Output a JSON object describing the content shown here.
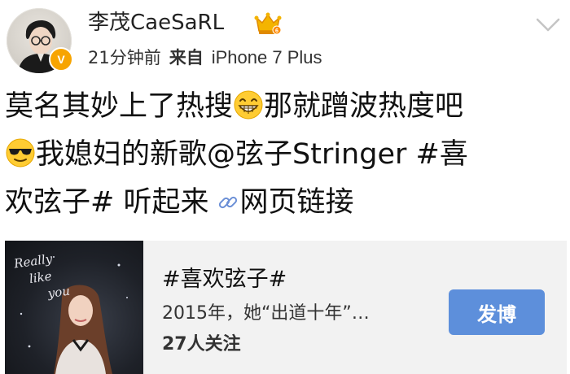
{
  "header": {
    "username": "李茂CaeSaRL",
    "verified_badge": "V",
    "time_ago": "21分钟前",
    "source_label": "来自",
    "device": "iPhone 7 Plus",
    "icons": {
      "avatar": "avatar-photo",
      "vip": "crown-icon",
      "menu": "chevron-down-icon"
    }
  },
  "post": {
    "line1_a": "莫名其妙上了热搜",
    "line1_b": "那就蹭波热度吧",
    "line2": "我媳妇的新歌@弦子Stringer #喜",
    "line3_a": "欢弦子# 听起来",
    "link_text": "网页链接",
    "emojis": [
      "grin-emoji",
      "cool-sunglasses-emoji"
    ],
    "link_icon": "link-icon"
  },
  "card": {
    "album_text": [
      "Really",
      "like",
      "you"
    ],
    "topic_title": "#喜欢弦子#",
    "description": "2015年，她“出道十年”…",
    "followers": "27人关注",
    "button_label": "发博"
  },
  "colors": {
    "accent_button": "#5d8fdb",
    "verified": "#f7a400",
    "card_bg": "#f2f2f2"
  }
}
